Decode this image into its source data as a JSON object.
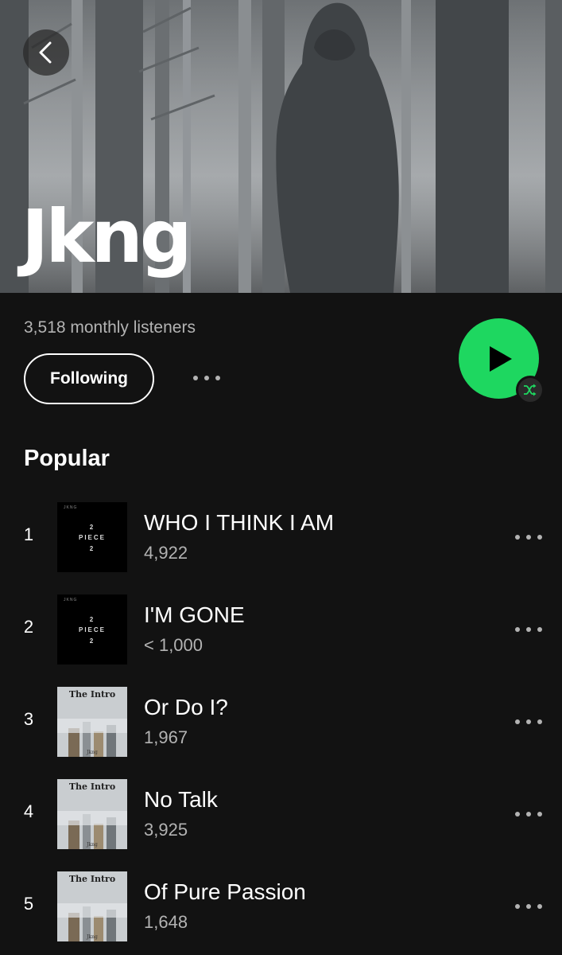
{
  "artist": {
    "name": "Jkng",
    "monthly_listeners": "3,518 monthly listeners"
  },
  "actions": {
    "following_label": "Following"
  },
  "section": {
    "title": "Popular"
  },
  "colors": {
    "accent": "#1ed760",
    "background": "#121212",
    "secondary_text": "#b3b3b3"
  },
  "icons": {
    "back": "chevron-left-icon",
    "play": "play-icon",
    "shuffle": "shuffle-icon",
    "more": "more-horizontal-icon"
  },
  "tracks": [
    {
      "number": "1",
      "title": "WHO I THINK I AM",
      "plays": "4,922",
      "cover": {
        "style": "piece",
        "tag": "JKNG",
        "top": "2",
        "mid": "PIECE",
        "bottom": "2"
      }
    },
    {
      "number": "2",
      "title": "I'M GONE",
      "plays": "< 1,000",
      "cover": {
        "style": "piece",
        "tag": "JKNG",
        "top": "2",
        "mid": "PIECE",
        "bottom": "2"
      }
    },
    {
      "number": "3",
      "title": "Or Do I?",
      "plays": "1,967",
      "cover": {
        "style": "intro",
        "title": "The Intro",
        "artist": "Jkng"
      }
    },
    {
      "number": "4",
      "title": "No Talk",
      "plays": "3,925",
      "cover": {
        "style": "intro",
        "title": "The Intro",
        "artist": "Jkng"
      }
    },
    {
      "number": "5",
      "title": "Of Pure Passion",
      "plays": "1,648",
      "cover": {
        "style": "intro",
        "title": "The Intro",
        "artist": "Jkng"
      }
    }
  ]
}
